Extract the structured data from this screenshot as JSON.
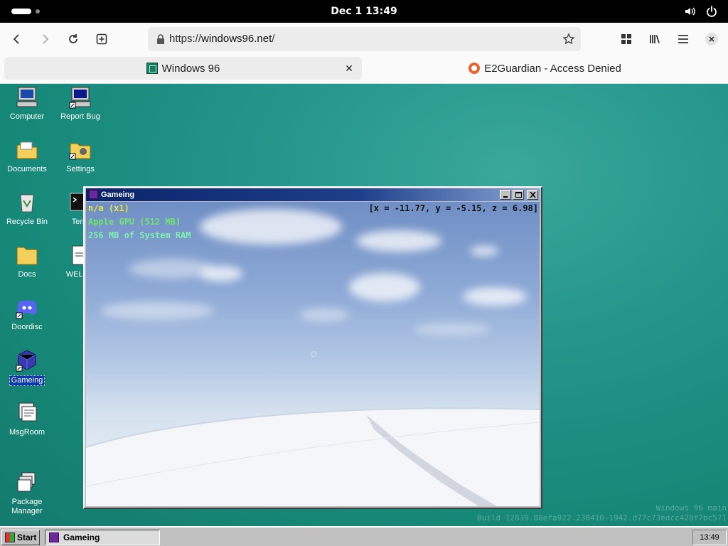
{
  "system": {
    "clock": "Dec 1  13:49"
  },
  "browser": {
    "url_prefix": "https://",
    "url_host": "windows96.net",
    "url_suffix": "/",
    "tabs": [
      {
        "title": "Windows 96",
        "active": true,
        "icon": "windows96-favicon"
      },
      {
        "title": "E2Guardian - Access Denied",
        "active": false,
        "icon": "e2guardian-favicon"
      }
    ],
    "tab_close_glyph": "✕"
  },
  "desktop": {
    "icons": [
      {
        "label": "Computer",
        "icon": "computer-icon"
      },
      {
        "label": "Report Bug",
        "icon": "report-bug-icon"
      },
      {
        "label": "Documents",
        "icon": "documents-folder-icon"
      },
      {
        "label": "Settings",
        "icon": "settings-icon"
      },
      {
        "label": "Recycle Bin",
        "icon": "recycle-bin-icon"
      },
      {
        "label": "Term",
        "icon": "terminal-icon"
      },
      {
        "label": "Docs",
        "icon": "folder-icon"
      },
      {
        "label": "WELCO",
        "icon": "welcome-icon"
      },
      {
        "label": "Doordisc",
        "icon": "discord-icon"
      },
      {
        "label": "Gameing",
        "icon": "game-cube-icon",
        "selected": true
      },
      {
        "label": "MsgRoom",
        "icon": "msgroom-icon"
      },
      {
        "label": "Package\nManager",
        "icon": "package-manager-icon"
      }
    ],
    "watermark": {
      "line1": "Windows 96 main",
      "line2": "Build 12839.88efa922.230410-1942.d77c73edcc428f7bc571"
    }
  },
  "game_window": {
    "title": "Gameing",
    "hud": {
      "line1": "n/a (x1)",
      "line2": "Apple GPU (512 MB)",
      "line3": "256 MB of System RAM",
      "coords": "[x = -11.77, y = -5.15, z = 6.98]"
    }
  },
  "taskbar": {
    "start_label": "Start",
    "task_label": "Gameing",
    "clock": "13:49"
  },
  "colors": {
    "desktop_teal": "#168878",
    "titlebar_blue": "#0a246a",
    "hud_yellow": "#e6e640",
    "hud_green": "#6ee66e",
    "hud_mint": "#7ef0b0"
  }
}
